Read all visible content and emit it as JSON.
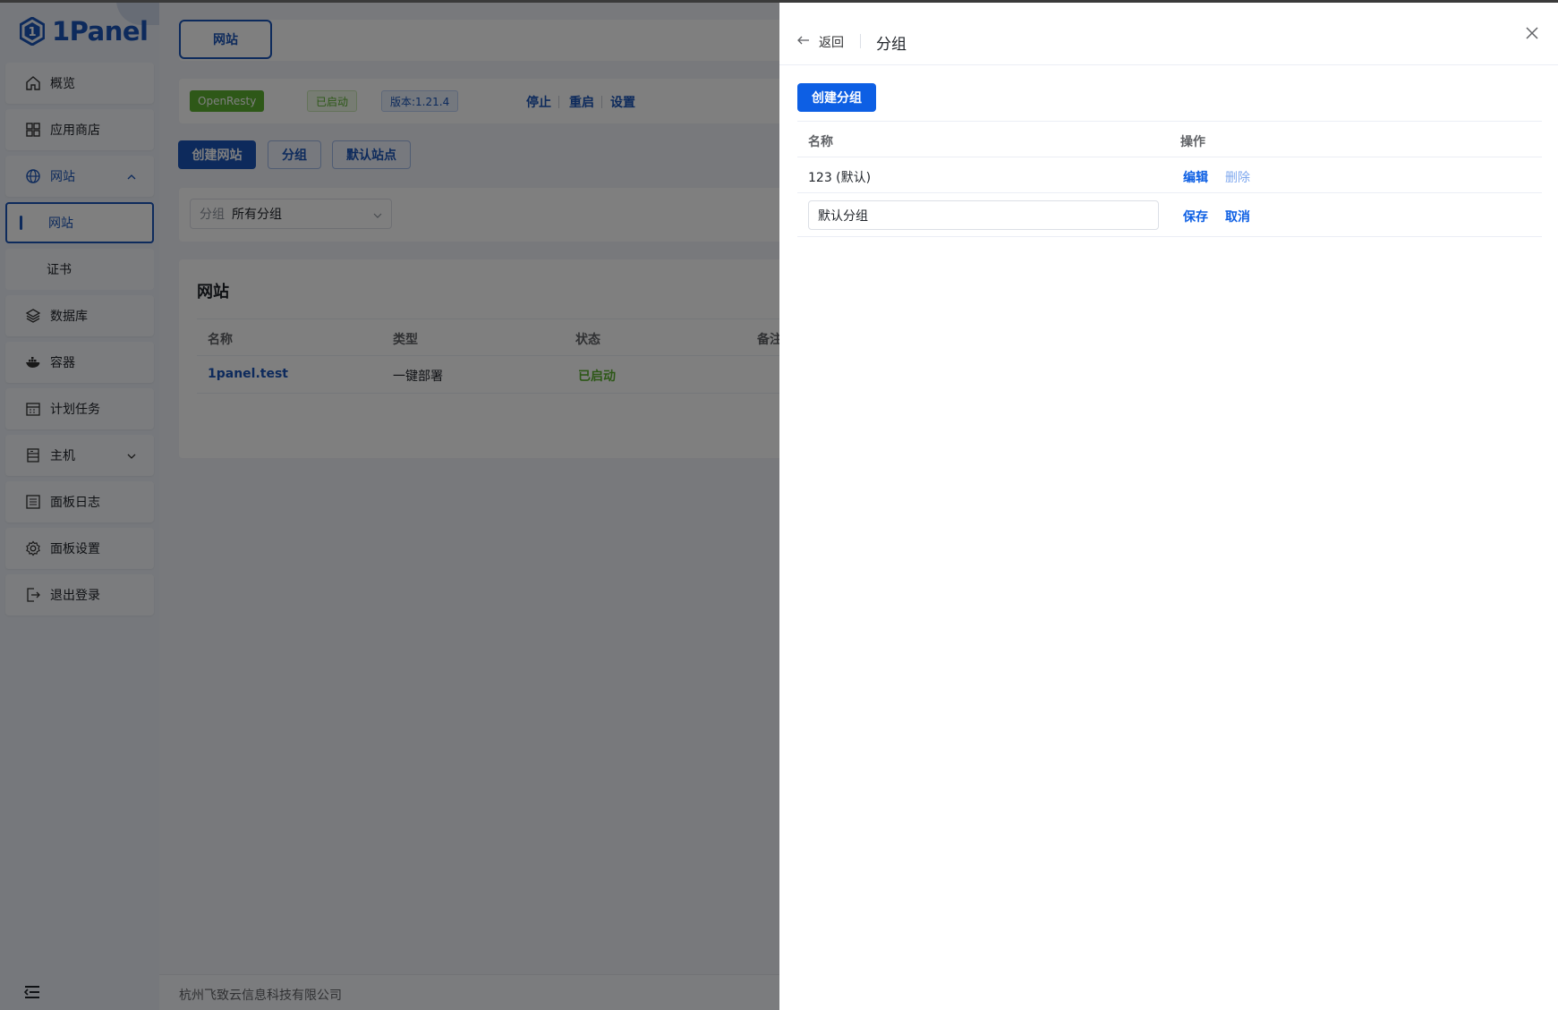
{
  "app": {
    "brand": "1Panel"
  },
  "sidebar": {
    "items": [
      {
        "label": "概览"
      },
      {
        "label": "应用商店"
      },
      {
        "label": "网站"
      },
      {
        "label": "网站"
      },
      {
        "label": "证书"
      },
      {
        "label": "数据库"
      },
      {
        "label": "容器"
      },
      {
        "label": "计划任务"
      },
      {
        "label": "主机"
      },
      {
        "label": "面板日志"
      },
      {
        "label": "面板设置"
      },
      {
        "label": "退出登录"
      }
    ]
  },
  "main": {
    "tab_label": "网站",
    "app_status": {
      "name": "OpenResty",
      "status": "已启动",
      "version": "版本:1.21.4",
      "actions": [
        "停止",
        "重启",
        "设置"
      ]
    },
    "toolbar": {
      "create": "创建网站",
      "group": "分组",
      "default_site": "默认站点"
    },
    "filter": {
      "prefix": "分组",
      "value": "所有分组"
    },
    "card_title": "网站",
    "table": {
      "headers": [
        "名称",
        "类型",
        "状态",
        "备注"
      ],
      "rows": [
        {
          "name": "1panel.test",
          "type": "一键部署",
          "status": "已启动"
        }
      ]
    },
    "footer": "杭州飞致云信息科技有限公司"
  },
  "drawer": {
    "back_label": "返回",
    "title": "分组",
    "create_button": "创建分组",
    "table": {
      "headers": [
        "名称",
        "操作"
      ],
      "rows": [
        {
          "name": "123 (默认)",
          "actions": [
            "编辑",
            "删除"
          ]
        }
      ],
      "edit_row": {
        "value": "默认分组",
        "actions": [
          "保存",
          "取消"
        ]
      }
    }
  },
  "colors": {
    "primary": "#1a55b8",
    "accent": "#0d5fe4",
    "success": "#5cb130"
  }
}
